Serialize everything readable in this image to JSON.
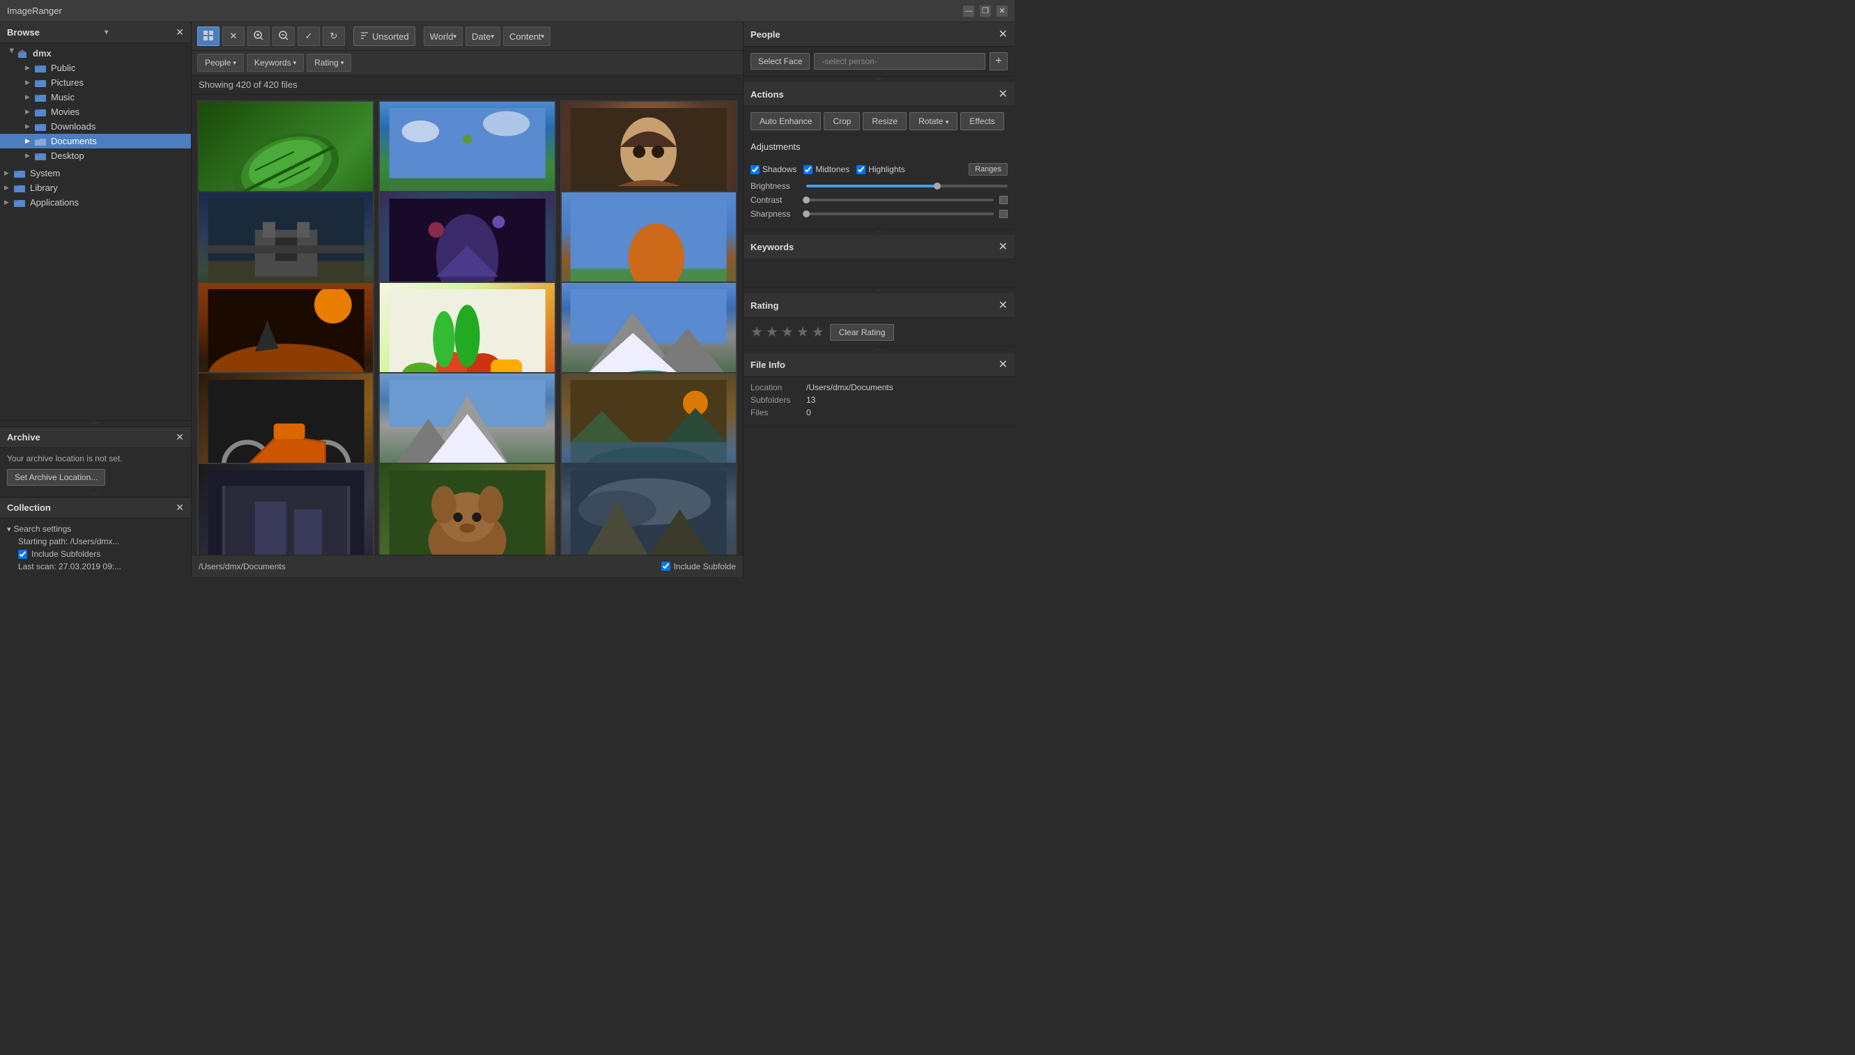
{
  "app": {
    "title": "ImageRanger",
    "window_controls": {
      "minimize": "—",
      "restore": "❐",
      "close": "✕"
    }
  },
  "left_sidebar": {
    "browse_panel": {
      "title": "Browse",
      "close_btn": "✕",
      "expand_arrow": "▾",
      "tree": {
        "root": {
          "label": "dmx",
          "arrow": "▶",
          "children": [
            {
              "label": "Public",
              "indent": 1
            },
            {
              "label": "Pictures",
              "indent": 1
            },
            {
              "label": "Music",
              "indent": 1
            },
            {
              "label": "Movies",
              "indent": 1
            },
            {
              "label": "Downloads",
              "indent": 1
            },
            {
              "label": "Documents",
              "indent": 1,
              "selected": true
            },
            {
              "label": "Desktop",
              "indent": 1
            }
          ]
        },
        "system": {
          "label": "System",
          "indent": 0
        },
        "library": {
          "label": "Library",
          "indent": 0
        },
        "applications": {
          "label": "Applications",
          "indent": 0
        }
      }
    },
    "archive_panel": {
      "title": "Archive",
      "close_btn": "✕",
      "message": "Your archive location is not set.",
      "set_btn": "Set Archive Location..."
    },
    "collection_panel": {
      "title": "Collection",
      "close_btn": "✕",
      "search_settings_label": "Search settings",
      "starting_path_label": "Starting path: /Users/dmx...",
      "include_subfolders_label": "Include Subfolders",
      "include_subfolders_checked": true,
      "last_scan_label": "Last scan: 27.03.2019 09:..."
    }
  },
  "toolbar": {
    "grid_btn": "⊞",
    "select_btn": "✕",
    "zoom_in_btn": "⊕",
    "zoom_out_btn": "⊖",
    "check_btn": "✓",
    "refresh_btn": "↻",
    "sort_label": "Unsorted",
    "world_btn": "World",
    "date_btn": "Date",
    "content_btn": "Content"
  },
  "filter_toolbar": {
    "people_btn": "People",
    "keywords_btn": "Keywords",
    "rating_btn": "Rating"
  },
  "gallery": {
    "status": "Showing 420 of 420 files",
    "items": [
      {
        "id": 0,
        "type": "leaf"
      },
      {
        "id": 1,
        "type": "sky"
      },
      {
        "id": 2,
        "type": "girl"
      },
      {
        "id": 3,
        "type": "castle"
      },
      {
        "id": 4,
        "type": "fantasy"
      },
      {
        "id": 5,
        "type": "tree"
      },
      {
        "id": 6,
        "type": "surf"
      },
      {
        "id": 7,
        "type": "veggie"
      },
      {
        "id": 8,
        "type": "mountain"
      },
      {
        "id": 9,
        "type": "moto"
      },
      {
        "id": 10,
        "type": "alps"
      },
      {
        "id": 11,
        "type": "lake"
      },
      {
        "id": 12,
        "type": "dark"
      },
      {
        "id": 13,
        "type": "dog"
      },
      {
        "id": 14,
        "type": "storm"
      }
    ]
  },
  "footer": {
    "path": "/Users/dmx/Documents",
    "include_subfolders_label": "Include Subfolde",
    "include_subfolders_checked": true
  },
  "right_sidebar": {
    "people_panel": {
      "title": "People",
      "close_btn": "✕",
      "select_face_btn": "Select Face",
      "select_person_placeholder": "-select person-",
      "add_btn": "+"
    },
    "actions_panel": {
      "title": "Actions",
      "close_btn": "✕",
      "buttons": {
        "auto_enhance": "Auto Enhance",
        "crop": "Crop",
        "resize": "Resize",
        "rotate": "Rotate",
        "effects": "Effects"
      },
      "adjustments": {
        "title": "Adjustments",
        "shadows_checked": true,
        "shadows_label": "Shadows",
        "midtones_checked": true,
        "midtones_label": "Midtones",
        "highlights_checked": true,
        "highlights_label": "Highlights",
        "ranges_btn": "Ranges",
        "brightness_label": "Brightness",
        "brightness_value": 65,
        "contrast_label": "Contrast",
        "contrast_value": 0,
        "sharpness_label": "Sharpness",
        "sharpness_value": 0
      }
    },
    "keywords_panel": {
      "title": "Keywords",
      "close_btn": "✕"
    },
    "rating_panel": {
      "title": "Rating",
      "close_btn": "✕",
      "stars_count": 5,
      "active_stars": 0,
      "clear_rating_btn": "Clear Rating"
    },
    "file_info_panel": {
      "title": "File Info",
      "close_btn": "✕",
      "rows": [
        {
          "key": "Location",
          "value": "/Users/dmx/Documents"
        },
        {
          "key": "Subfolders",
          "value": "13"
        },
        {
          "key": "Files",
          "value": "0"
        }
      ]
    }
  }
}
